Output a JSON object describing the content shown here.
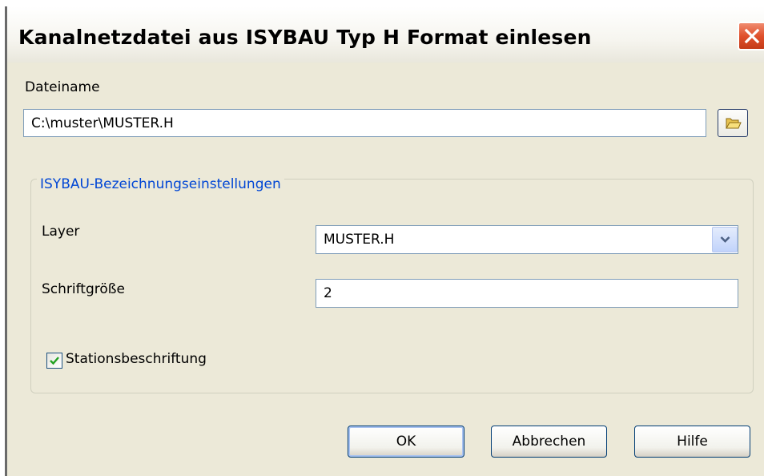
{
  "window": {
    "title": "Kanalnetzdatei aus ISYBAU Typ H Format einlesen"
  },
  "file": {
    "label": "Dateiname",
    "value": "C:\\muster\\MUSTER.H"
  },
  "group": {
    "legend": "ISYBAU-Bezeichnungseinstellungen",
    "layer": {
      "label": "Layer",
      "selected": "MUSTER.H"
    },
    "font_size": {
      "label": "Schriftgröße",
      "value": "2"
    },
    "station_label": {
      "label": "Stationsbeschriftung",
      "checked": true
    }
  },
  "buttons": {
    "ok": "OK",
    "cancel": "Abbrechen",
    "help": "Hilfe"
  },
  "icons": {
    "close": "close-icon",
    "browse": "folder-open-icon",
    "dropdown": "chevron-down-icon",
    "check": "checkmark-icon"
  },
  "colors": {
    "dialog_bg": "#ece9d8",
    "legend_text": "#0046d5",
    "close_button": "#e0502c",
    "check_mark": "#21a121"
  }
}
